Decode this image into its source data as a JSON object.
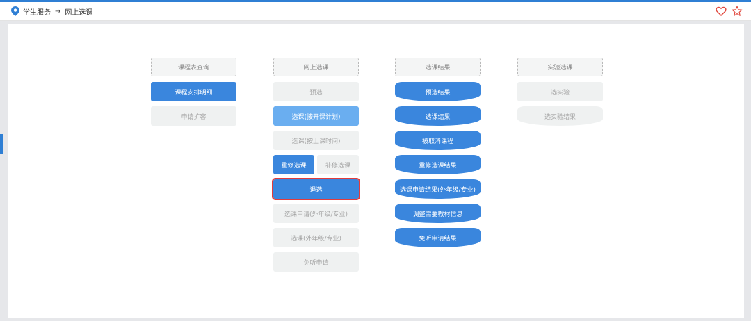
{
  "header": {
    "breadcrumb_parent": "学生服务",
    "breadcrumb_arrow": "→",
    "breadcrumb_current": "网上选课"
  },
  "colors": {
    "accent": "#3a86dd",
    "light_accent": "#6aaef0",
    "highlight_border": "#e23c3c",
    "heart": "#e0463c"
  },
  "icons": {
    "location": "location-pin-icon",
    "favorite": "heart-icon",
    "star": "star-icon"
  },
  "columns": {
    "col1": {
      "header": "课程表查询",
      "items": [
        "课程安排明细",
        "申请扩容"
      ]
    },
    "col2": {
      "header": "网上选课",
      "items": [
        "预选",
        "选课(按开课计划)",
        "选课(按上课时间)",
        "重修选课",
        "补修选课",
        "退选",
        "选课申请(外年级/专业)",
        "选课(外年级/专业)",
        "免听申请"
      ]
    },
    "col3": {
      "header": "选课结果",
      "items": [
        "预选结果",
        "选课结果",
        "被取消课程",
        "重修选课结果",
        "选课申请结果(外年级/专业)",
        "调整需要教材信息",
        "免听申请结果"
      ]
    },
    "col4": {
      "header": "实验选课",
      "items": [
        "选实验",
        "选实验结果"
      ]
    }
  }
}
